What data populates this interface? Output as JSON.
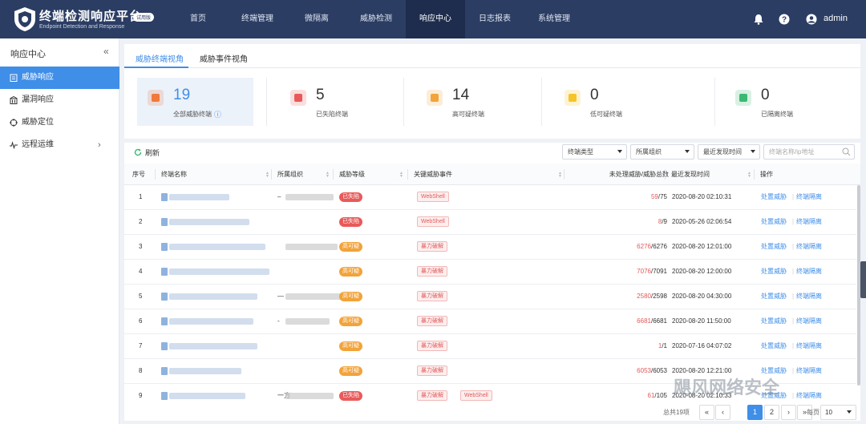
{
  "header": {
    "brand": "终端检测响应平台",
    "trial": "试用版",
    "subtitle": "Endpoint Detection and Response",
    "user": "admin",
    "nav": [
      "首页",
      "终端管理",
      "微隔离",
      "威胁检测",
      "响应中心",
      "日志报表",
      "系统管理"
    ],
    "active_nav": "响应中心"
  },
  "sidebar": {
    "title": "响应中心",
    "collapse": "«",
    "items": [
      {
        "label": "威胁响应",
        "active": true
      },
      {
        "label": "漏洞响应"
      },
      {
        "label": "威胁定位"
      },
      {
        "label": "远程运维",
        "chevron": "›"
      }
    ]
  },
  "tabs": [
    "威胁终端视角",
    "威胁事件视角"
  ],
  "stats": [
    {
      "value": "19",
      "label": "全部威胁终端",
      "color": "#f07a3c",
      "info": "ⓘ"
    },
    {
      "value": "5",
      "label": "已失陷终端",
      "color": "#e85a5a"
    },
    {
      "value": "14",
      "label": "高可疑终端",
      "color": "#f2a33a"
    },
    {
      "value": "0",
      "label": "低可疑终端",
      "color": "#f5c42a"
    },
    {
      "value": "0",
      "label": "已隔离终端",
      "color": "#3cb874"
    }
  ],
  "toolbar": {
    "refresh": "刷新",
    "filter1": "终端类型",
    "filter2": "所属组织",
    "filter3": "最近发现时间",
    "search_placeholder": "终端名称/ip地址"
  },
  "columns": [
    "序号",
    "终端名称",
    "所属组织",
    "威胁等级",
    "关键威胁事件",
    "未处理威胁/威胁总数",
    "最近发现时间",
    "操作"
  ],
  "rows": [
    {
      "no": "1",
      "level": "已失陷",
      "level_color": "#e85a5a",
      "events": [
        "WebShell"
      ],
      "unhandled": "59",
      "total": "/75",
      "time": "2020-08-20 02:10:31",
      "org": "–"
    },
    {
      "no": "2",
      "level": "已失陷",
      "level_color": "#e85a5a",
      "events": [
        "WebShell"
      ],
      "unhandled": "8",
      "total": "/9",
      "time": "2020-05-26 02:06:54",
      "org": ""
    },
    {
      "no": "3",
      "level": "高可疑",
      "level_color": "#f2a33a",
      "events": [
        "暴力破解"
      ],
      "unhandled": "6276",
      "total": "/6276",
      "time": "2020-08-20 12:01:00",
      "org": ""
    },
    {
      "no": "4",
      "level": "高可疑",
      "level_color": "#f2a33a",
      "events": [
        "暴力破解"
      ],
      "unhandled": "7076",
      "total": "/7091",
      "time": "2020-08-20 12:00:00",
      "org": ""
    },
    {
      "no": "5",
      "level": "高可疑",
      "level_color": "#f2a33a",
      "events": [
        "暴力破解"
      ],
      "unhandled": "2580",
      "total": "/2598",
      "time": "2020-08-20 04:30:00",
      "org": "—"
    },
    {
      "no": "6",
      "level": "高可疑",
      "level_color": "#f2a33a",
      "events": [
        "暴力破解"
      ],
      "unhandled": "6681",
      "total": "/6681",
      "time": "2020-08-20 11:50:00",
      "org": "-"
    },
    {
      "no": "7",
      "level": "高可疑",
      "level_color": "#f2a33a",
      "events": [
        "暴力破解"
      ],
      "unhandled": "1",
      "total": "/1",
      "time": "2020-07-16 04:07:02",
      "org": ""
    },
    {
      "no": "8",
      "level": "高可疑",
      "level_color": "#f2a33a",
      "events": [
        "暴力破解"
      ],
      "unhandled": "6053",
      "total": "/6053",
      "time": "2020-08-20 12:21:00",
      "org": ""
    },
    {
      "no": "9",
      "level": "已失陷",
      "level_color": "#e85a5a",
      "events": [
        "暴力破解",
        "WebShell"
      ],
      "unhandled": "61",
      "total": "/105",
      "time": "2020-08-20 02:10:33",
      "org": "一方"
    }
  ],
  "actions": {
    "handle": "处置威胁",
    "isolate": "终端隔离"
  },
  "pager": {
    "total": "总共19项",
    "pages": [
      "«",
      "‹",
      "1",
      "2",
      "›",
      "»"
    ],
    "current": "1",
    "per_page_label": "每页",
    "per_page": "10"
  },
  "watermark": "飓风网络安全"
}
